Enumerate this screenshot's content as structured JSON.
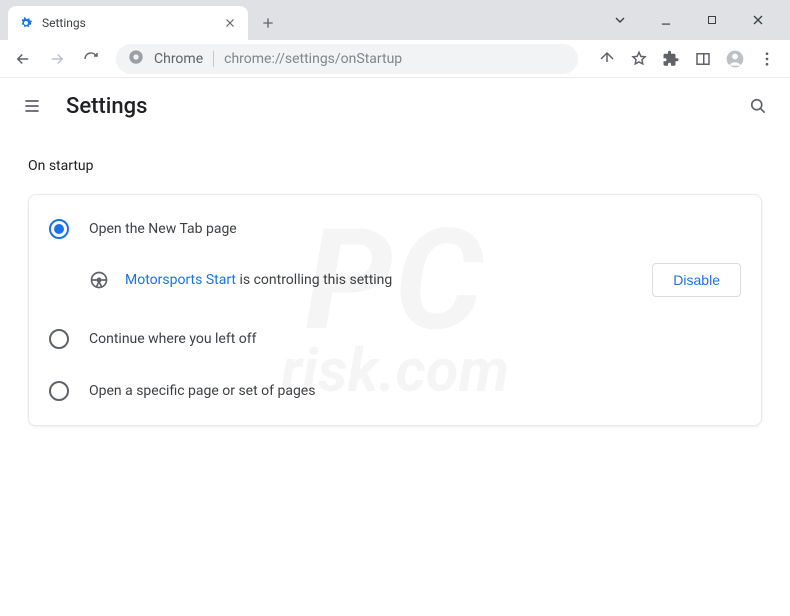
{
  "browser": {
    "tab_title": "Settings",
    "omnibox_prefix": "Chrome",
    "omnibox_url": "chrome://settings/onStartup"
  },
  "header": {
    "title": "Settings"
  },
  "page": {
    "section_title": "On startup",
    "options": [
      {
        "label": "Open the New Tab page"
      },
      {
        "label": "Continue where you left off"
      },
      {
        "label": "Open a specific page or set of pages"
      }
    ],
    "controlled": {
      "extension_name": "Motorsports Start",
      "suffix": " is controlling this setting",
      "disable_label": "Disable"
    }
  },
  "watermark": {
    "line1": "PC",
    "line2": "risk.com"
  }
}
